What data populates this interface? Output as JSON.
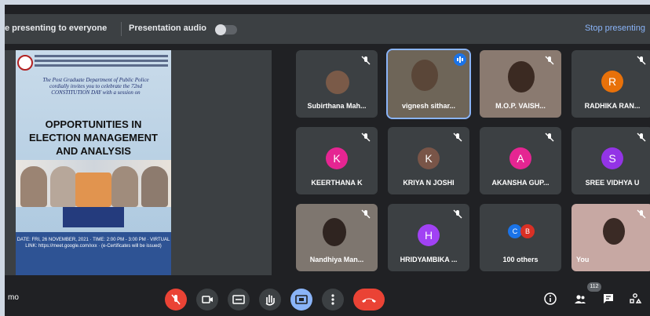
{
  "topbar": {
    "presenting_text": "e presenting to everyone",
    "audio_label": "Presentation audio",
    "stop_label": "Stop presenting"
  },
  "poster": {
    "intro_lines": "The Post Graduate Department of Public Police cordially invites you to celebrate the 72nd CONSTITUTION DAY with a session on",
    "headline_1": "OPPORTUNITIES IN",
    "headline_2": "ELECTION MANAGEMENT",
    "headline_3": "AND ANALYSIS",
    "footer": "DATE: FRI, 26 NOVEMBER, 2021 · TIME: 2:00 PM - 3:00 PM · VIRTUAL LINK: https://meet.google.com/xxx · (e-Certificates will be issued)"
  },
  "participants": [
    {
      "name": "Subirthana Mah...",
      "type": "photo",
      "muted": true
    },
    {
      "name": "vignesh sithar...",
      "type": "video",
      "speaking": true
    },
    {
      "name": "M.O.P. VAISH...",
      "type": "video",
      "muted": true
    },
    {
      "name": "RADHIKA RAN...",
      "type": "initial",
      "initial": "R",
      "color": "#e8710a",
      "muted": true
    },
    {
      "name": "KEERTHANA K",
      "type": "initial",
      "initial": "K",
      "color": "#e52592",
      "muted": true
    },
    {
      "name": "KRIYA N JOSHI",
      "type": "initial",
      "initial": "K",
      "color": "#795548",
      "muted": true
    },
    {
      "name": "AKANSHA GUP...",
      "type": "initial",
      "initial": "A",
      "color": "#e52592",
      "muted": true
    },
    {
      "name": "SREE VIDHYA U",
      "type": "initial",
      "initial": "S",
      "color": "#9334e6",
      "muted": true
    },
    {
      "name": "Nandhiya Man...",
      "type": "video",
      "muted": true
    },
    {
      "name": "HRIDYAMBIKA ...",
      "type": "initial",
      "initial": "H",
      "color": "#a142f4",
      "muted": true
    },
    {
      "name": "100 others",
      "type": "others",
      "initials": [
        "C",
        "B"
      ],
      "colors": [
        "#1a73e8",
        "#d93025"
      ]
    },
    {
      "name": "You",
      "type": "video",
      "muted": true
    }
  ],
  "bottombar": {
    "meeting_code": "mo",
    "participant_count": "112"
  }
}
